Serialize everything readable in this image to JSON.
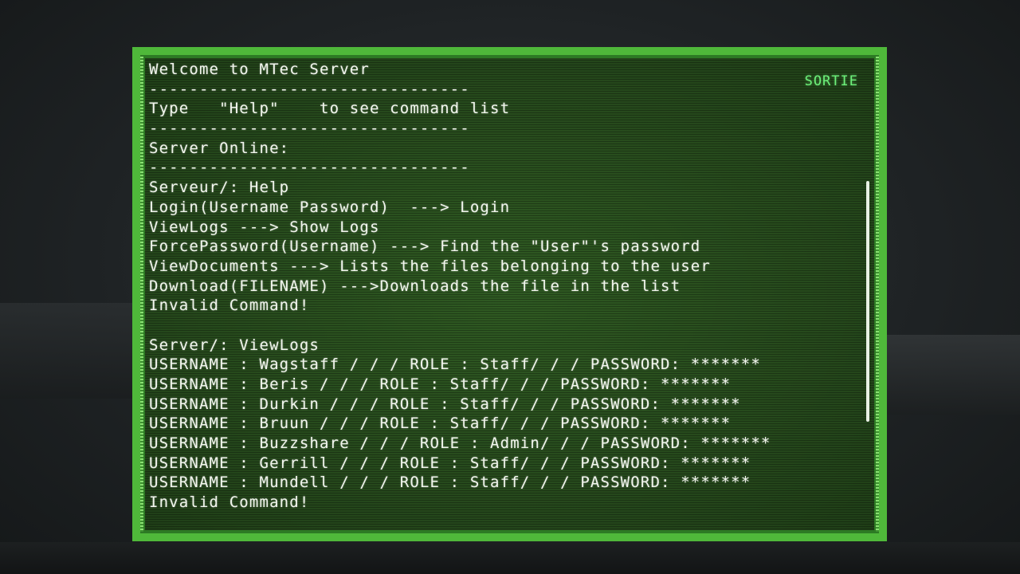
{
  "terminal": {
    "lines": [
      "Welcome to MTec Server",
      "--------------------------------",
      "Type   \"Help\"    to see command list",
      "--------------------------------",
      "Server Online:",
      "--------------------------------",
      "Serveur/: Help",
      "Login(Username Password)  ---> Login",
      "ViewLogs ---> Show Logs",
      "ForcePassword(Username) ---> Find the \"User\"'s password",
      "ViewDocuments ---> Lists the files belonging to the user",
      "Download(FILENAME) --->Downloads the file in the list",
      "Invalid Command!",
      "",
      "Server/: ViewLogs",
      "USERNAME : Wagstaff / / / ROLE : Staff/ / / PASSWORD: *******",
      "USERNAME : Beris / / / ROLE : Staff/ / / PASSWORD: *******",
      "USERNAME : Durkin / / / ROLE : Staff/ / / PASSWORD: *******",
      "USERNAME : Bruun / / / ROLE : Staff/ / / PASSWORD: *******",
      "USERNAME : Buzzshare / / / ROLE : Admin/ / / PASSWORD: *******",
      "USERNAME : Gerrill / / / ROLE : Staff/ / / PASSWORD: *******",
      "USERNAME : Mundell / / / ROLE : Staff/ / / PASSWORD: *******",
      "Invalid Command!"
    ]
  },
  "exit_button": {
    "label": "SORTIE"
  },
  "colors": {
    "frame": "#4fb83a",
    "screen": "#2a4f1f",
    "text": "#f2f6ee",
    "accent": "#6df07a"
  }
}
